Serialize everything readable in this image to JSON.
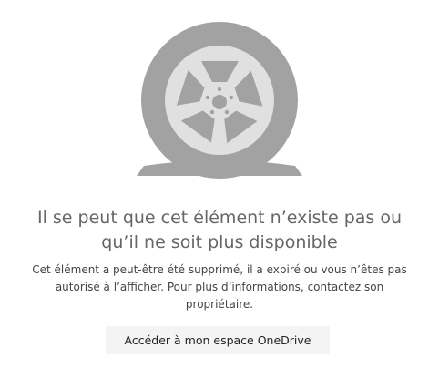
{
  "error": {
    "title_line1": "Il se peut que cet élément n’existe pas ou",
    "title_line2": "qu’il ne soit plus disponible",
    "description": "Cet élément a peut-être été supprimé, il a expiré ou vous n’êtes pas autorisé à l’afficher. Pour plus d’informations, contactez son propriétaire."
  },
  "actions": {
    "go_to_onedrive_label": "Accéder à mon espace OneDrive"
  },
  "illustration": {
    "icon": "flat-tire-icon",
    "tire_color": "#a2a2a2",
    "rim_color": "#e0e0e0",
    "detail_color": "#a2a2a2"
  }
}
